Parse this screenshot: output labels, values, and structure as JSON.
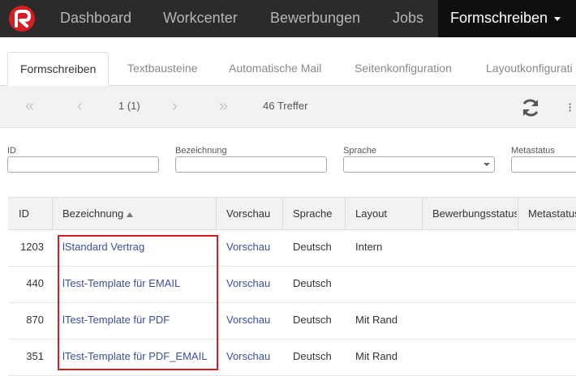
{
  "navbar": {
    "logo": "app-logo",
    "items": [
      {
        "label": "Dashboard"
      },
      {
        "label": "Workcenter"
      },
      {
        "label": "Bewerbungen"
      },
      {
        "label": "Jobs"
      },
      {
        "label": "Formschreiben",
        "active": true
      }
    ]
  },
  "tabs": [
    {
      "label": "Formschreiben",
      "active": true
    },
    {
      "label": "Textbausteine"
    },
    {
      "label": "Automatische Mail"
    },
    {
      "label": "Seitenkonfiguration"
    },
    {
      "label": "Layoutkonfigurati"
    }
  ],
  "pager": {
    "page_info": "1 (1)",
    "hits": "46 Treffer",
    "first_icon": "double-chevron-left-icon",
    "prev_icon": "chevron-left-icon",
    "next_icon": "chevron-right-icon",
    "last_icon": "double-chevron-right-icon",
    "refresh_icon": "refresh-icon"
  },
  "filters": {
    "id_label": "ID",
    "bezeichnung_label": "Bezeichnung",
    "sprache_label": "Sprache",
    "metastatus_label": "Metastatus"
  },
  "table": {
    "headers": [
      "ID",
      "Bezeichnung",
      "Vorschau",
      "Sprache",
      "Layout",
      "Bewerbungsstatus",
      "Metastatus"
    ],
    "rows": [
      {
        "id": "1203",
        "bezeichnung": "lStandard Vertrag",
        "vorschau": "Vorschau",
        "sprache": "Deutsch",
        "layout": "Intern"
      },
      {
        "id": "440",
        "bezeichnung": "lTest-Template für EMAIL",
        "vorschau": "Vorschau",
        "sprache": "Deutsch",
        "layout": ""
      },
      {
        "id": "870",
        "bezeichnung": "lTest-Template für PDF",
        "vorschau": "Vorschau",
        "sprache": "Deutsch",
        "layout": "Mit Rand"
      },
      {
        "id": "351",
        "bezeichnung": "lTest-Template für PDF_EMAIL",
        "vorschau": "Vorschau",
        "sprache": "Deutsch",
        "layout": "Mit Rand"
      }
    ]
  },
  "colors": {
    "navbar_bg": "#2b2b2b",
    "active_nav_bg": "#0f0f0f",
    "logo_red": "#d51e24",
    "link_blue": "#3b4fa0",
    "highlight_red": "#d51e24"
  }
}
